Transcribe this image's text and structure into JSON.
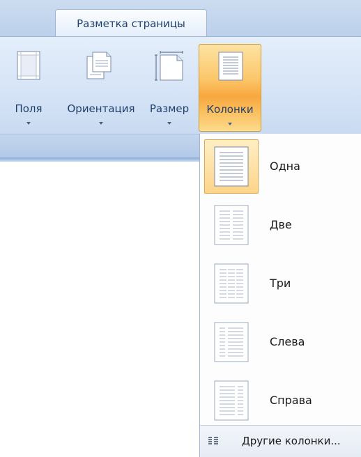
{
  "ribbon": {
    "active_tab": "Разметка страницы",
    "buttons": [
      {
        "label": "Поля",
        "icon": "margins-icon"
      },
      {
        "label": "Ориентация",
        "icon": "orientation-icon"
      },
      {
        "label": "Размер",
        "icon": "page-size-icon"
      },
      {
        "label": "Колонки",
        "icon": "columns-icon",
        "state": "open"
      }
    ]
  },
  "columns_menu": {
    "items": [
      {
        "label": "Одна",
        "icon": "one-column-icon",
        "selected": true
      },
      {
        "label": "Две",
        "icon": "two-columns-icon"
      },
      {
        "label": "Три",
        "icon": "three-columns-icon"
      },
      {
        "label": "Слева",
        "icon": "left-column-icon"
      },
      {
        "label": "Справа",
        "icon": "right-column-icon"
      }
    ],
    "more": {
      "label": "Другие колонки...",
      "icon": "more-columns-icon"
    }
  },
  "colors": {
    "accent": "#f8a83e",
    "ribbon": "#d6e4f6",
    "text": "#1f3f6c"
  }
}
